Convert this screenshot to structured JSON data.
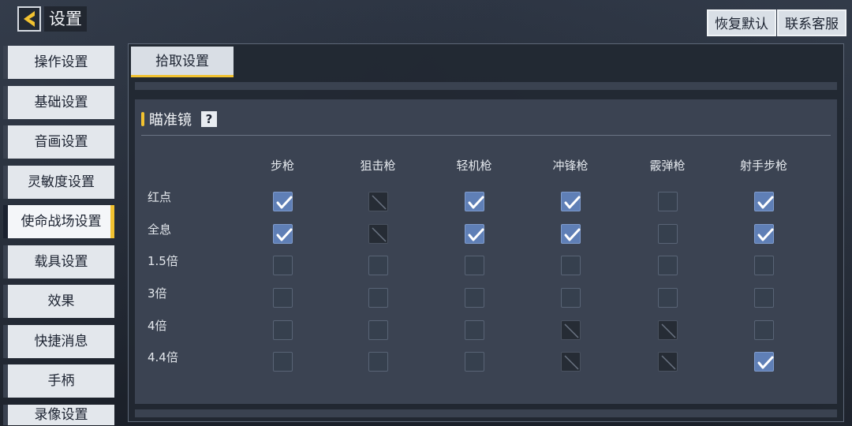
{
  "header": {
    "title": "设置",
    "restore_label": "恢复默认",
    "contact_label": "联系客服"
  },
  "sidebar": {
    "items": [
      {
        "label": "操作设置"
      },
      {
        "label": "基础设置"
      },
      {
        "label": "音画设置"
      },
      {
        "label": "灵敏度设置"
      },
      {
        "label": "使命战场设置",
        "active": true
      },
      {
        "label": "载具设置"
      },
      {
        "label": "效果"
      },
      {
        "label": "快捷消息"
      },
      {
        "label": "手柄"
      },
      {
        "label": "录像设置"
      }
    ]
  },
  "main": {
    "tab_label": "拾取设置",
    "section_title": "瞄准镜",
    "help_icon": "?",
    "columns": [
      "步枪",
      "狙击枪",
      "轻机枪",
      "冲锋枪",
      "霰弹枪",
      "射手步枪"
    ],
    "rows": [
      {
        "label": "红点",
        "states": [
          "checked",
          "disabled",
          "checked",
          "checked",
          "unchecked",
          "checked"
        ]
      },
      {
        "label": "全息",
        "states": [
          "checked",
          "disabled",
          "checked",
          "checked",
          "unchecked",
          "checked"
        ]
      },
      {
        "label": "1.5倍",
        "states": [
          "unchecked",
          "unchecked",
          "unchecked",
          "unchecked",
          "unchecked",
          "unchecked"
        ]
      },
      {
        "label": "3倍",
        "states": [
          "unchecked",
          "unchecked",
          "unchecked",
          "unchecked",
          "unchecked",
          "unchecked"
        ]
      },
      {
        "label": "4倍",
        "states": [
          "unchecked",
          "unchecked",
          "unchecked",
          "disabled",
          "disabled",
          "unchecked"
        ]
      },
      {
        "label": "4.4倍",
        "states": [
          "unchecked",
          "unchecked",
          "unchecked",
          "disabled",
          "disabled",
          "checked"
        ]
      }
    ]
  },
  "colors": {
    "accent": "#f2c230",
    "checkbox_checked": "#5f7fb6"
  },
  "icons": {
    "back": "back-arrow-icon",
    "help": "help-icon",
    "check": "checkmark-icon",
    "disabled": "disabled-slash-icon"
  }
}
